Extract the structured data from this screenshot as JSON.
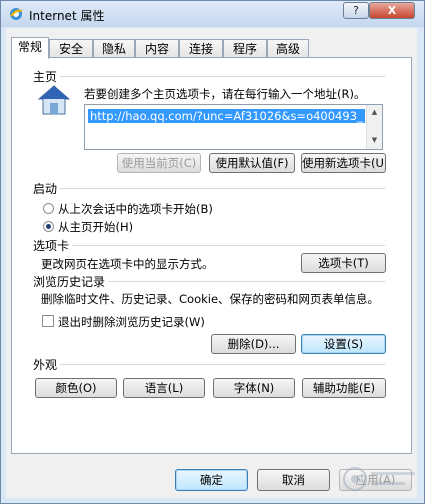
{
  "window": {
    "title": "Internet 属性"
  },
  "titlebar": {
    "help_label": "?",
    "close_label": "X"
  },
  "tabs": [
    {
      "label": "常规",
      "active": true
    },
    {
      "label": "安全"
    },
    {
      "label": "隐私"
    },
    {
      "label": "内容"
    },
    {
      "label": "连接"
    },
    {
      "label": "程序"
    },
    {
      "label": "高级"
    }
  ],
  "home": {
    "section_label": "主页",
    "description": "若要创建多个主页选项卡，请在每行输入一个地址(R)。",
    "url": "http://hao.qq.com/?unc=Af31026&s=o400493_",
    "buttons": {
      "use_current": "使用当前页(C)",
      "use_default": "使用默认值(F)",
      "use_new_tab": "使用新选项卡(U)"
    }
  },
  "startup": {
    "section_label": "启动",
    "options": [
      {
        "label": "从上次会话中的选项卡开始(B)",
        "checked": false
      },
      {
        "label": "从主页开始(H)",
        "checked": true
      }
    ]
  },
  "tabs_section": {
    "section_label": "选项卡",
    "description": "更改网页在选项卡中的显示方式。",
    "button": "选项卡(T)"
  },
  "history": {
    "section_label": "浏览历史记录",
    "description": "删除临时文件、历史记录、Cookie、保存的密码和网页表单信息。",
    "checkbox_label": "退出时删除浏览历史记录(W)",
    "delete_button": "删除(D)...",
    "settings_button": "设置(S)"
  },
  "appearance": {
    "section_label": "外观",
    "buttons": [
      "颜色(O)",
      "语言(L)",
      "字体(N)",
      "辅助功能(E)"
    ]
  },
  "footer": {
    "ok": "确定",
    "cancel": "取消",
    "apply": "应用(A)"
  },
  "colors": {
    "selection": "#3399ff",
    "titlebar": "#c5d7ef",
    "close_button": "#c7452f"
  }
}
